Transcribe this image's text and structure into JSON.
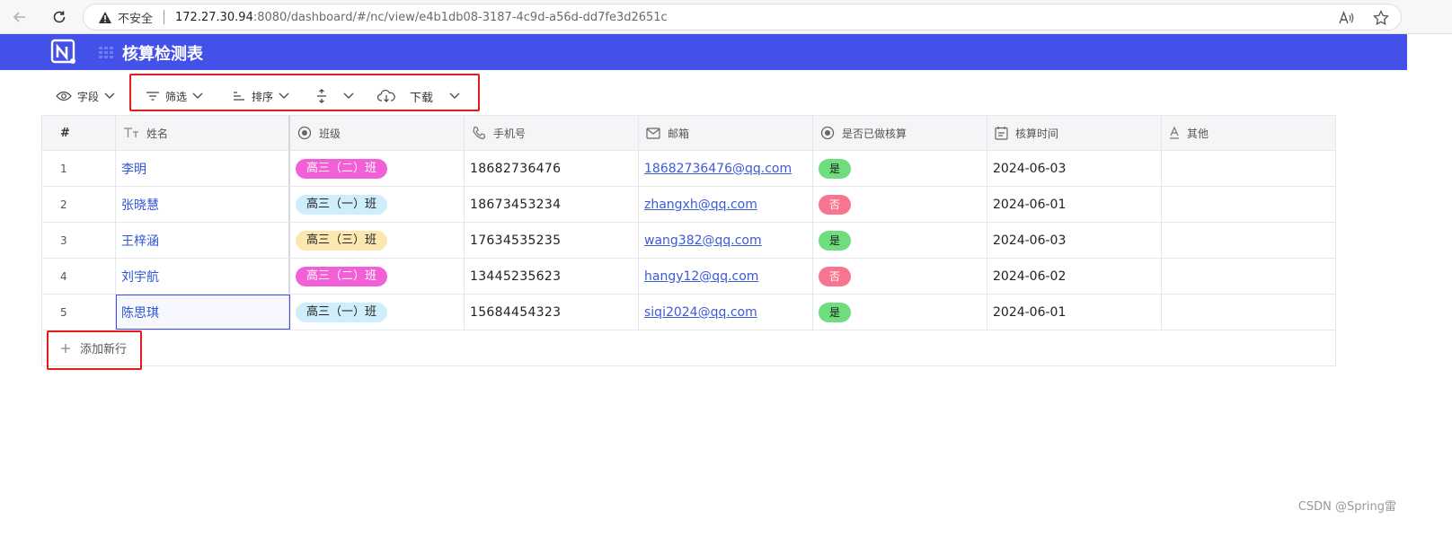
{
  "browser": {
    "insecure_label": "不安全",
    "url_host": "172.27.30.94",
    "url_rest": ":8080/dashboard/#/nc/view/e4b1db08-3187-4c9d-a56d-dd7fe3d2651c"
  },
  "app": {
    "title": "核算检测表",
    "brand_color": "#4351e8"
  },
  "toolbar": {
    "fields_label": "字段",
    "filter_label": "筛选",
    "sort_label": "排序",
    "download_label": "下载"
  },
  "table": {
    "headers": [
      "#",
      "姓名",
      "班级",
      "手机号",
      "邮箱",
      "是否已做核算",
      "核算时间",
      "其他"
    ],
    "rows": [
      {
        "num": "1",
        "name": "李明",
        "class": "高三（二）班",
        "class_color": "#f25fd7",
        "class_text_color": "#ffffff",
        "phone": "18682736476",
        "email": "18682736476@qq.com",
        "done": "是",
        "done_color": "#6fdc7f",
        "time": "2024-06-03",
        "other": ""
      },
      {
        "num": "2",
        "name": "张晓慧",
        "class": "高三（一）班",
        "class_color": "#cfeefc",
        "class_text_color": "#222222",
        "phone": "18673453234",
        "email": "zhangxh@qq.com",
        "done": "否",
        "done_color": "#f7758f",
        "time": "2024-06-01",
        "other": ""
      },
      {
        "num": "3",
        "name": "王梓涵",
        "class": "高三（三）班",
        "class_color": "#fde7b1",
        "class_text_color": "#222222",
        "phone": "17634535235",
        "email": "wang382@qq.com",
        "done": "是",
        "done_color": "#6fdc7f",
        "time": "2024-06-03",
        "other": ""
      },
      {
        "num": "4",
        "name": "刘宇航",
        "class": "高三（二）班",
        "class_color": "#f25fd7",
        "class_text_color": "#ffffff",
        "phone": "13445235623",
        "email": "hangy12@qq.com",
        "done": "否",
        "done_color": "#f7758f",
        "time": "2024-06-02",
        "other": ""
      },
      {
        "num": "5",
        "name": "陈思琪",
        "class": "高三（一）班",
        "class_color": "#cfeefc",
        "class_text_color": "#222222",
        "phone": "15684454323",
        "email": "siqi2024@qq.com",
        "done": "是",
        "done_color": "#6fdc7f",
        "time": "2024-06-01",
        "other": ""
      }
    ],
    "add_row_label": "添加新行"
  },
  "watermark": "CSDN @Spring雷"
}
